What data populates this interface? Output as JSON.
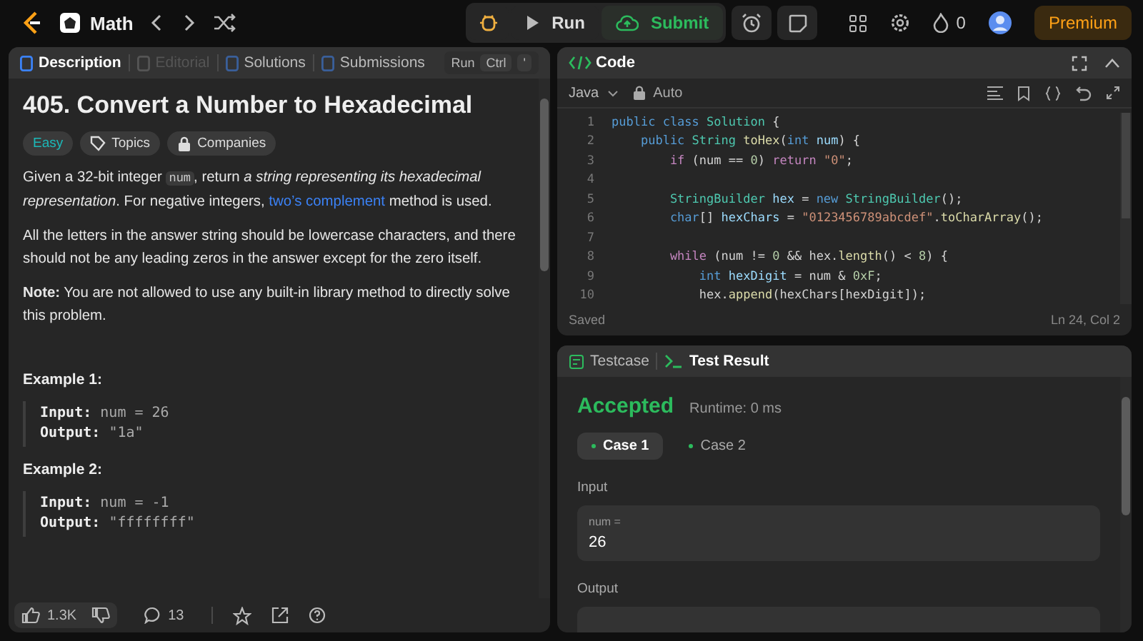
{
  "topbar": {
    "problem_list": "Math",
    "run": "Run",
    "submit": "Submit",
    "streak": "0",
    "premium": "Premium"
  },
  "description_tabs": [
    {
      "label": "Description",
      "selected": true,
      "disabled": false
    },
    {
      "label": "Editorial",
      "selected": false,
      "disabled": true
    },
    {
      "label": "Solutions",
      "selected": false,
      "disabled": false
    },
    {
      "label": "Submissions",
      "selected": false,
      "disabled": false
    }
  ],
  "tooltip": {
    "action": "Run",
    "keys": [
      "Ctrl",
      "'"
    ]
  },
  "problem": {
    "title": "405. Convert a Number to Hexadecimal",
    "difficulty": "Easy",
    "tags": [
      "Topics",
      "Companies"
    ],
    "paragraphs": [
      [
        {
          "kind": "text",
          "text": "Given a 32-bit integer "
        },
        {
          "kind": "code",
          "text": "num"
        },
        {
          "kind": "text",
          "text": ", return "
        },
        {
          "kind": "italic",
          "text": "a string representing its hexadecimal representation"
        },
        {
          "kind": "text",
          "text": ". For negative integers, "
        },
        {
          "kind": "link",
          "text": "two’s complement"
        },
        {
          "kind": "text",
          "text": " method is used."
        }
      ],
      [
        {
          "kind": "text",
          "text": "All the letters in the answer string should be lowercase characters, and there should not be any leading zeros in the answer except for the zero itself."
        }
      ],
      [
        {
          "kind": "rich",
          "text": "**Note:** You are not allowed to use any built-in library method to directly solve this problem."
        }
      ]
    ],
    "examples": [
      {
        "title": "Example 1:",
        "lines": [
          {
            "label": "Input:",
            "value": "num = 26"
          },
          {
            "label": "Output:",
            "value": "\"1a\""
          }
        ]
      },
      {
        "title": "Example 2:",
        "lines": [
          {
            "label": "Input:",
            "value": "num = -1"
          },
          {
            "label": "Output:",
            "value": "\"ffffffff\""
          }
        ]
      }
    ]
  },
  "footer": {
    "likes": "1.3K",
    "comments": "13"
  },
  "code": {
    "title": "Code",
    "language": "Java",
    "mode": "Auto",
    "status": "Saved",
    "cursor": "Ln 24, Col 2",
    "lines": [
      {
        "number": "1",
        "tokens": [
          {
            "kind": "kw",
            "text": "public class "
          },
          {
            "kind": "type",
            "text": "Solution"
          },
          {
            "kind": "plain",
            "text": " {"
          }
        ]
      },
      {
        "number": "2",
        "tokens": [
          {
            "kind": "kw",
            "text": "    public "
          },
          {
            "kind": "type",
            "text": "String "
          },
          {
            "kind": "fn",
            "text": "toHex"
          },
          {
            "kind": "plain",
            "text": "("
          },
          {
            "kind": "kw",
            "text": "int "
          },
          {
            "kind": "var",
            "text": "num"
          },
          {
            "kind": "plain",
            "text": ") {"
          }
        ]
      },
      {
        "number": "3",
        "tokens": [
          {
            "kind": "ctl",
            "text": "        if "
          },
          {
            "kind": "plain",
            "text": "(num == "
          },
          {
            "kind": "num",
            "text": "0"
          },
          {
            "kind": "plain",
            "text": ") "
          },
          {
            "kind": "ctl",
            "text": "return "
          },
          {
            "kind": "str",
            "text": "\"0\""
          },
          {
            "kind": "plain",
            "text": ";"
          }
        ]
      },
      {
        "number": "4"
      },
      {
        "number": "5",
        "tokens": [
          {
            "kind": "type",
            "text": "        StringBuilder "
          },
          {
            "kind": "var",
            "text": "hex"
          },
          {
            "kind": "plain",
            "text": " = "
          },
          {
            "kind": "kw",
            "text": "new "
          },
          {
            "kind": "type",
            "text": "StringBuilder"
          },
          {
            "kind": "plain",
            "text": "();"
          }
        ]
      },
      {
        "number": "6",
        "tokens": [
          {
            "kind": "kw",
            "text": "        char"
          },
          {
            "kind": "plain",
            "text": "[] "
          },
          {
            "kind": "var",
            "text": "hexChars"
          },
          {
            "kind": "plain",
            "text": " = "
          },
          {
            "kind": "str",
            "text": "\"0123456789abcdef\""
          },
          {
            "kind": "plain",
            "text": "."
          },
          {
            "kind": "fn",
            "text": "toCharArray"
          },
          {
            "kind": "plain",
            "text": "();"
          }
        ]
      },
      {
        "number": "7"
      },
      {
        "number": "8",
        "tokens": [
          {
            "kind": "ctl",
            "text": "        while "
          },
          {
            "kind": "plain",
            "text": "(num != "
          },
          {
            "kind": "num",
            "text": "0"
          },
          {
            "kind": "plain",
            "text": " && hex."
          },
          {
            "kind": "fn",
            "text": "length"
          },
          {
            "kind": "plain",
            "text": "() < "
          },
          {
            "kind": "num",
            "text": "8"
          },
          {
            "kind": "plain",
            "text": ") {"
          }
        ]
      },
      {
        "number": "9",
        "tokens": [
          {
            "kind": "kw",
            "text": "            int "
          },
          {
            "kind": "var",
            "text": "hexDigit"
          },
          {
            "kind": "plain",
            "text": " = num & "
          },
          {
            "kind": "num",
            "text": "0xF"
          },
          {
            "kind": "plain",
            "text": ";"
          }
        ]
      },
      {
        "number": "10",
        "tokens": [
          {
            "kind": "plain",
            "text": "            hex."
          },
          {
            "kind": "fn",
            "text": "append"
          },
          {
            "kind": "plain",
            "text": "(hexChars[hexDigit]);"
          }
        ]
      }
    ]
  },
  "result_tabs": [
    {
      "label": "Testcase",
      "selected": false
    },
    {
      "label": "Test Result",
      "selected": true
    }
  ],
  "result": {
    "verdict": "Accepted",
    "runtime": "Runtime: 0 ms",
    "cases": [
      {
        "label": "Case 1",
        "selected": true
      },
      {
        "label": "Case 2",
        "selected": false
      }
    ],
    "input_label": "Input",
    "input_name": "num =",
    "input_value": "26",
    "output_label": "Output"
  }
}
